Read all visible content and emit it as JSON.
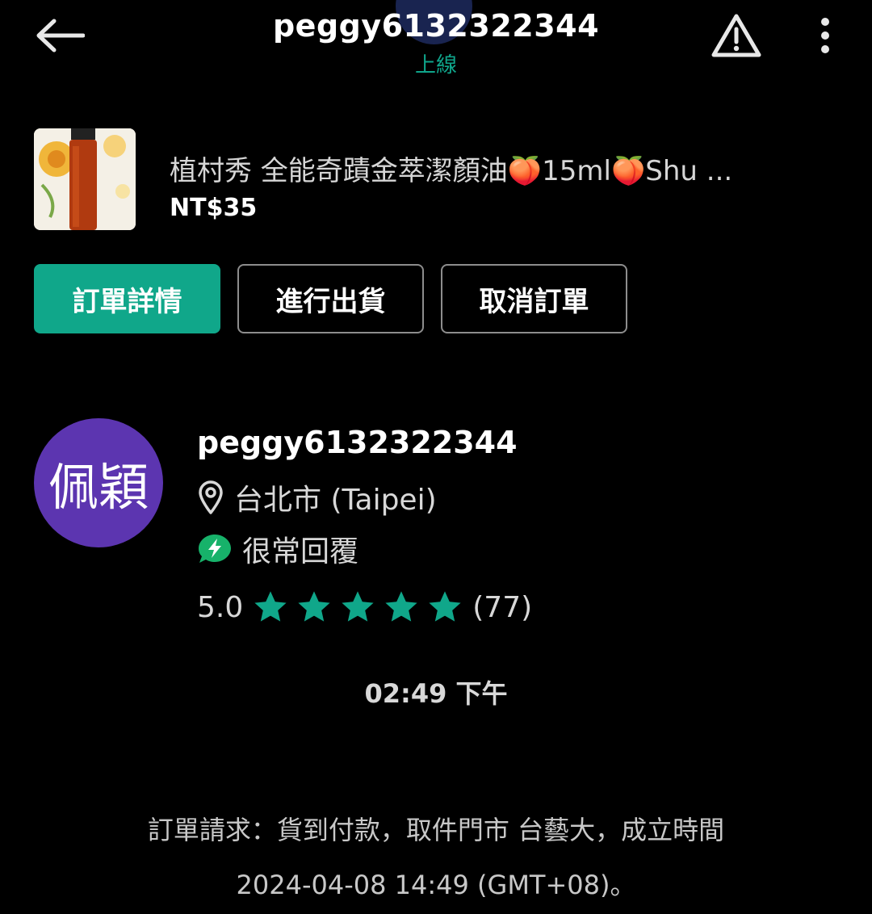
{
  "header": {
    "title": "peggy6132322344",
    "status": "上線",
    "icons": {
      "back": "arrow-left-icon",
      "report": "warning-triangle-icon",
      "more": "more-vertical-icon"
    }
  },
  "product": {
    "title": "植村秀 全能奇蹟金萃潔顏油🍑15ml🍑Shu ...",
    "price": "NT$35"
  },
  "actions": {
    "details": "訂單詳情",
    "ship": "進行出貨",
    "cancel": "取消訂單"
  },
  "seller": {
    "avatar_text": "佩穎",
    "name": "peggy6132322344",
    "location": "台北市 (Taipei)",
    "response": "很常回覆",
    "rating": "5.0",
    "stars": 5,
    "review_count": "(77)"
  },
  "message": {
    "time": "02:49 下午",
    "line1": "訂單請求：貨到付款，取件門市 台藝大，成立時間",
    "line2": "2024-04-08 14:49 (GMT+08)。"
  },
  "colors": {
    "accent": "#10a78a",
    "avatar": "#5c35b0",
    "background": "#000000"
  }
}
